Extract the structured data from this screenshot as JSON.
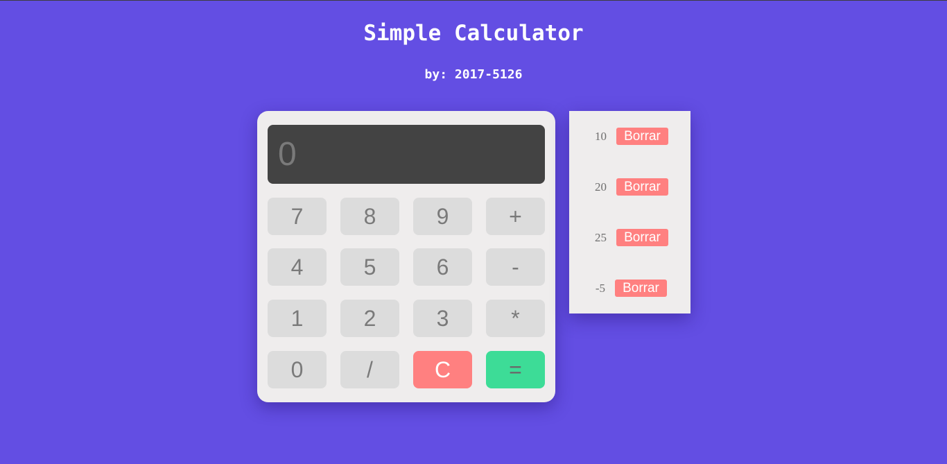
{
  "header": {
    "title": "Simple Calculator",
    "subtitle": "by: 2017-5126"
  },
  "calculator": {
    "display_value": "0",
    "keys": [
      "7",
      "8",
      "9",
      "+",
      "4",
      "5",
      "6",
      "-",
      "1",
      "2",
      "3",
      "*",
      "0",
      "/",
      "C",
      "="
    ]
  },
  "history": {
    "items": [
      {
        "value": "10",
        "delete_label": "Borrar"
      },
      {
        "value": "20",
        "delete_label": "Borrar"
      },
      {
        "value": "25",
        "delete_label": "Borrar"
      },
      {
        "value": "-5",
        "delete_label": "Borrar"
      }
    ]
  },
  "colors": {
    "background": "#634ee3",
    "panel": "#efeded",
    "display": "#434343",
    "key": "#dcdcdc",
    "clear": "#ff8080",
    "equals": "#3ddc97",
    "delete": "#ff8080"
  }
}
